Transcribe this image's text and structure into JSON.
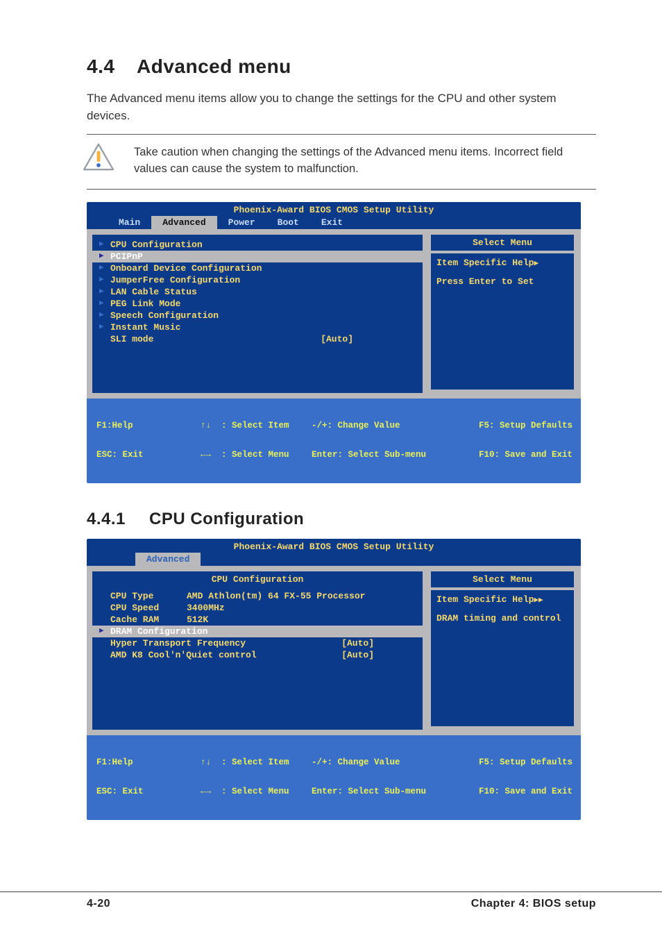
{
  "heading": {
    "number": "4.4",
    "title": "Advanced menu"
  },
  "intro": "The Advanced menu items allow you to change the settings for the CPU and other system devices.",
  "caution": "Take caution when changing the settings of the Advanced menu items. Incorrect field values can cause the system to malfunction.",
  "bios1": {
    "title": "Phoenix-Award BIOS CMOS Setup Utility",
    "tabs": [
      "Main",
      "Advanced",
      "Power",
      "Boot",
      "Exit"
    ],
    "active_tab": "Advanced",
    "items": [
      {
        "label": "CPU Configuration",
        "arrow": true
      },
      {
        "label": "PCIPnP",
        "arrow": true,
        "selected": true
      },
      {
        "label": "Onboard Device Configuration",
        "arrow": true
      },
      {
        "label": "JumperFree Configuration",
        "arrow": true
      },
      {
        "label": "LAN Cable Status",
        "arrow": true
      },
      {
        "label": "PEG Link Mode",
        "arrow": true
      },
      {
        "label": "Speech Configuration",
        "arrow": true
      },
      {
        "label": "Instant Music",
        "arrow": true
      },
      {
        "label": "SLI mode",
        "arrow": false,
        "value": "[Auto]"
      }
    ],
    "right": {
      "menu_header": "Select Menu",
      "help_title": "Item Specific Help",
      "help_body": "Press Enter to Set"
    },
    "footer": {
      "f1": "F1:Help",
      "esc": "ESC: Exit",
      "updown_item": ": Select Item",
      "updown_menu": ": Select Menu",
      "change": "-/+: Change Value",
      "enter": "Enter: Select Sub-menu",
      "f5": "F5: Setup Defaults",
      "f10": "F10: Save and Exit"
    }
  },
  "subheading": {
    "number": "4.4.1",
    "title": "CPU Configuration"
  },
  "bios2": {
    "title": "Phoenix-Award BIOS CMOS Setup Utility",
    "tab": "Advanced",
    "section_header": "CPU Configuration",
    "rows": [
      {
        "label": "CPU Type",
        "value": "AMD Athlon(tm) 64 FX-55 Processor"
      },
      {
        "label": "CPU Speed",
        "value": "3400MHz"
      },
      {
        "label": "Cache RAM",
        "value": "512K"
      },
      {
        "label": "DRAM Configuration",
        "arrow": true,
        "selected": true
      },
      {
        "label": "Hyper Transport Frequency",
        "value": "[Auto]"
      },
      {
        "label": "AMD K8 Cool'n'Quiet control",
        "value": "[Auto]"
      }
    ],
    "right": {
      "menu_header": "Select Menu",
      "help_title": "Item Specific Help",
      "help_body": "DRAM timing and control"
    },
    "footer": {
      "f1": "F1:Help",
      "esc": "ESC: Exit",
      "updown_item": ": Select Item",
      "updown_menu": ": Select Menu",
      "change": "-/+: Change Value",
      "enter": "Enter: Select Sub-menu",
      "f5": "F5: Setup Defaults",
      "f10": "F10: Save and Exit"
    }
  },
  "footer": {
    "left": "4-20",
    "right": "Chapter 4: BIOS setup"
  }
}
